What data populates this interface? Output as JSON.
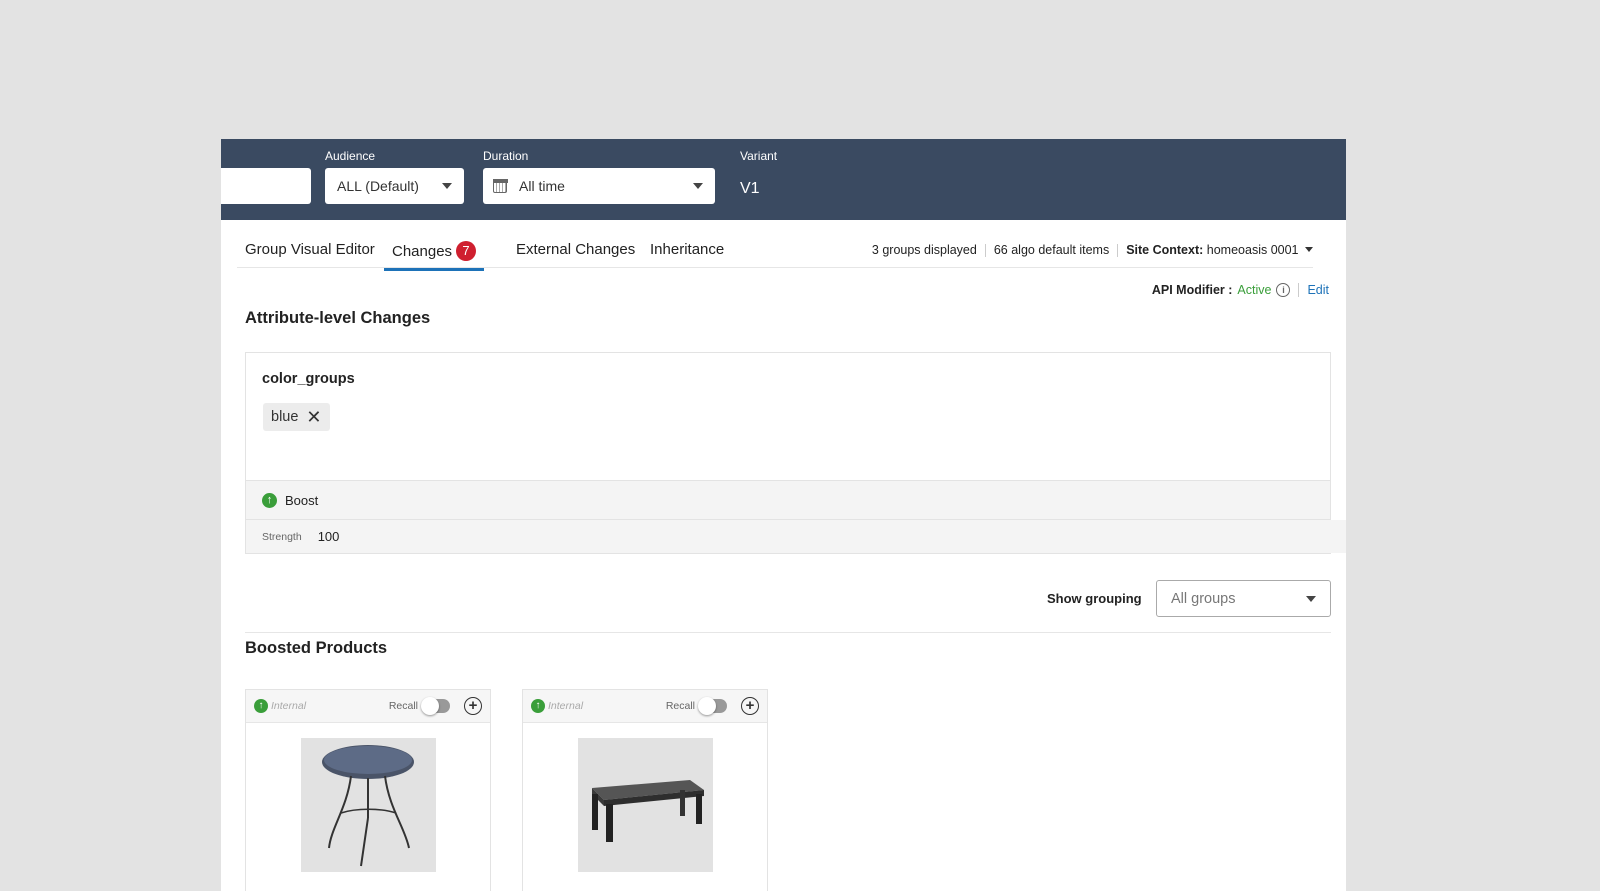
{
  "header": {
    "audience_label": "Audience",
    "audience_value": "ALL (Default)",
    "duration_label": "Duration",
    "duration_value": "All time",
    "variant_label": "Variant",
    "variant_value": "V1"
  },
  "tabs": [
    {
      "label": "Group Visual Editor"
    },
    {
      "label": "Changes",
      "badge": "7"
    },
    {
      "label": "External Changes"
    },
    {
      "label": "Inheritance"
    }
  ],
  "stats": {
    "groups": "3 groups displayed",
    "algo": "66 algo default items",
    "site_context_label": "Site Context:",
    "site_context_value": "homeoasis 0001"
  },
  "api_modifier": {
    "label": "API Modifier :",
    "status": "Active",
    "edit": "Edit"
  },
  "attribute_section": {
    "title": "Attribute-level Changes",
    "attribute": "color_groups",
    "chip": "blue",
    "action": "Boost",
    "strength_label": "Strength",
    "strength_value": "100"
  },
  "grouping": {
    "label": "Show grouping",
    "value": "All groups"
  },
  "boosted": {
    "title": "Boosted Products",
    "products": [
      {
        "tag": "Internal",
        "recall_label": "Recall"
      },
      {
        "tag": "Internal",
        "recall_label": "Recall"
      }
    ]
  },
  "colors": {
    "header_bg": "#3a4a61",
    "accent": "#1d72b8",
    "badge": "#cf1f2f",
    "active_green": "#3a9e3a"
  }
}
